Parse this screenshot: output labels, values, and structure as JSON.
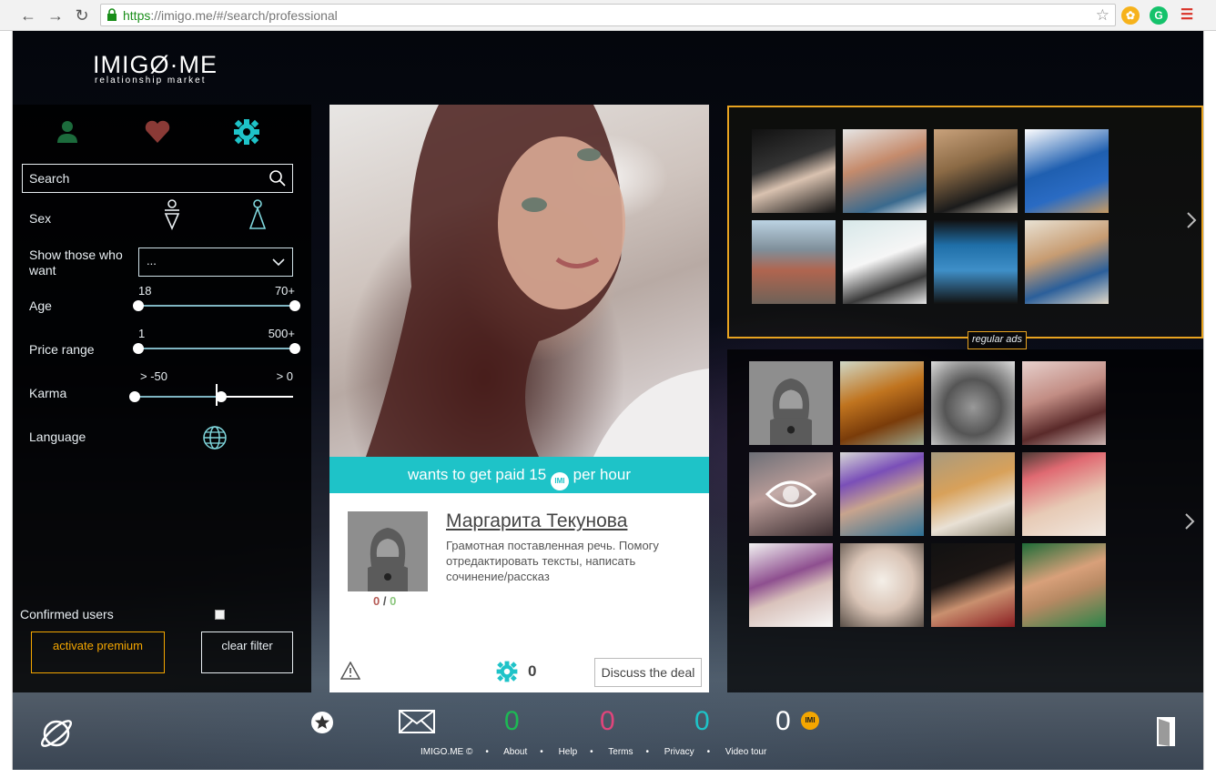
{
  "browser": {
    "url_scheme": "https",
    "url_rest": "://imigo.me/#/search/professional"
  },
  "logo": {
    "name": "IMIGØ·ME",
    "tagline": "relationship market"
  },
  "sidebar": {
    "tabs": [
      "person-icon",
      "heart-icon",
      "gear-icon"
    ],
    "search_placeholder": "Search",
    "sex_label": "Sex",
    "show_label": "Show those who want",
    "show_value": "...",
    "age_label": "Age",
    "age_min": "18",
    "age_max": "70+",
    "price_label": "Price range",
    "price_min": "1",
    "price_max": "500+",
    "karma_label": "Karma",
    "karma_min": "> -50",
    "karma_max": "> 0",
    "language_label": "Language",
    "confirmed_label": "Confirmed users",
    "premium_button": "activate premium",
    "clear_button": "clear filter"
  },
  "profile": {
    "paid_prefix": "wants to get paid 15",
    "paid_suffix": "per hour",
    "coin_label": "IMI",
    "name": "Маргарита Текунова",
    "description": "Грамотная поставленная речь. Помогу отредактировать тексты, написать сочинение/рассказ",
    "karma_neg": "0",
    "karma_sep": "/",
    "karma_pos": "0",
    "gear_count": "0",
    "discuss_button": "Discuss the deal"
  },
  "ads": {
    "label": "regular ads"
  },
  "bottom": {
    "counters": [
      "0",
      "0",
      "0",
      "0"
    ],
    "colors": {
      "green": "#1db954",
      "pink": "#e0457b",
      "teal": "#1ec3c8",
      "white": "#ffffff",
      "gold": "#f4a600"
    },
    "footer": [
      "IMIGO.ME ©",
      "About",
      "Help",
      "Terms",
      "Privacy",
      "Video tour"
    ]
  },
  "colors": {
    "accent": "#1ec3c8",
    "premium": "#f4a600",
    "ad_border": "#e8a320"
  }
}
